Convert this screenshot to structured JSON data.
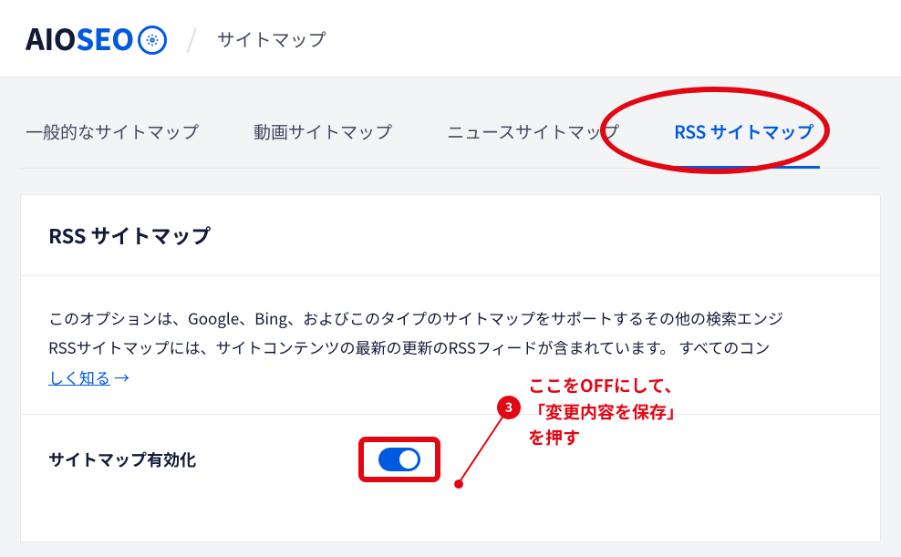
{
  "header": {
    "logo_aio": "AIO",
    "logo_seo": "SEO",
    "breadcrumb": "サイトマップ"
  },
  "tabs": {
    "general": "一般的なサイトマップ",
    "video": "動画サイトマップ",
    "news": "ニュースサイトマップ",
    "rss": "RSS サイトマップ"
  },
  "card": {
    "title": "RSS サイトマップ",
    "desc_line1": "このオプションは、Google、Bing、およびこのタイプのサイトマップをサポートするその他の検索エンジ",
    "desc_line2": "RSSサイトマップには、サイトコンテンツの最新の更新のRSSフィードが含まれています。 すべてのコン",
    "link": "しく知る",
    "arrow": "→",
    "row_label": "サイトマップ有効化"
  },
  "annotation": {
    "badge": "3",
    "line1": "ここをOFFにして、",
    "line2": "「変更内容を保存」",
    "line3": "を押す"
  }
}
